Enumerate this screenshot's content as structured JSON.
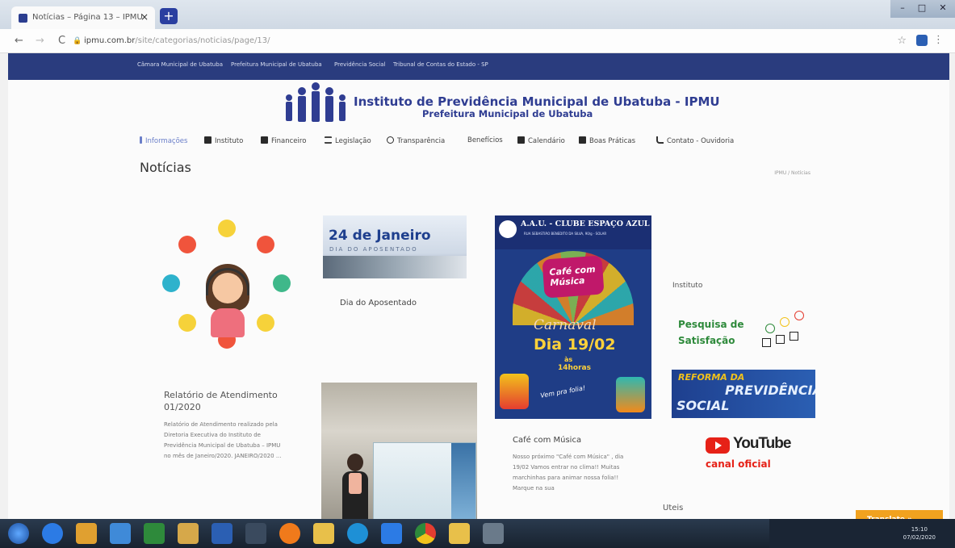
{
  "browser": {
    "tab_title": "Notícias – Página 13 – IPMU",
    "tab_close": "×",
    "new_tab": "+",
    "url_domain": "ipmu.com.br",
    "url_path": "/site/categorias/noticias/page/13/",
    "back": "←",
    "forward": "→",
    "reload": "C",
    "star": "☆",
    "kebab": "⋮",
    "window_controls": [
      "–",
      "□",
      "✕"
    ]
  },
  "top_links": [
    "Câmara Municipal de Ubatuba",
    "Prefeitura Municipal de Ubatuba",
    "Previdência Social",
    "Tribunal de Contas do Estado - SP"
  ],
  "header": {
    "title": "Instituto de Previdência Municipal de Ubatuba - IPMU",
    "subtitle": "Prefeitura Municipal de Ubatuba"
  },
  "menu": [
    {
      "label": "Informações",
      "icon": "info-icon"
    },
    {
      "label": "Instituto",
      "icon": "building-icon"
    },
    {
      "label": "Financeiro",
      "icon": "money-icon"
    },
    {
      "label": "Legislação",
      "icon": "list-icon"
    },
    {
      "label": "Transparência",
      "icon": "search-icon"
    },
    {
      "label": "Benefícios",
      "icon": ""
    },
    {
      "label": "Calendário",
      "icon": "calendar-icon"
    },
    {
      "label": "Boas Práticas",
      "icon": "thumbs-up-icon"
    },
    {
      "label": "Contato - Ouvidoria",
      "icon": "phone-icon"
    }
  ],
  "page": {
    "heading": "Notícias",
    "breadcrumb": "IPMU / Notícias"
  },
  "posts": [
    {
      "title": "Relatório de Atendimento 01/2020",
      "excerpt": "Relatório de Atendimento realizado pela Diretoria Executiva do Instituto de Previdência Municipal de Ubatuba – IPMU no mês de Janeiro/2020. JANEIRO/2020 ..."
    },
    {
      "title": "Dia do Aposentado",
      "image_headline": "24 de Janeiro",
      "image_caption": "DIA DO APOSENTADO"
    },
    {
      "title": "Café com Música",
      "excerpt": "Nosso próximo \"Café com Música\" , dia 19/02 Vamos entrar no clima!! Muitas marchinhas para animar nossa folia!! Marque na sua",
      "poster": {
        "club": "A.A.U. - CLUBE ESPAÇO AZUL",
        "club_address": "RUA SEBASTIÃO BENEDITO DA SILVA, 90/g - SOLAR",
        "badge_line": "Café com Música",
        "carnaval": "Carnaval",
        "date": "Dia 19/02",
        "as": "às",
        "hour": "14horas",
        "tagline": "Vem pra folia!"
      }
    }
  ],
  "sidebar": {
    "heading": "Instituto",
    "survey_line1": "Pesquisa de",
    "survey_line2": "Satisfação",
    "reform_line1": "REFORMA DA",
    "reform_line2": "PREVIDÊNCIA",
    "reform_line3": "SOCIAL",
    "youtube_word": "YouTube",
    "youtube_caption": "canal oficial",
    "uteis": "Uteis"
  },
  "translate_label": "Translate »",
  "taskbar": {
    "clock_time": "15:10",
    "clock_date": "07/02/2020"
  },
  "colors": {
    "brand_blue": "#2f3d92",
    "topbar": "#2a3c7e",
    "translate": "#f1a21f",
    "youtube_red": "#e62117"
  }
}
